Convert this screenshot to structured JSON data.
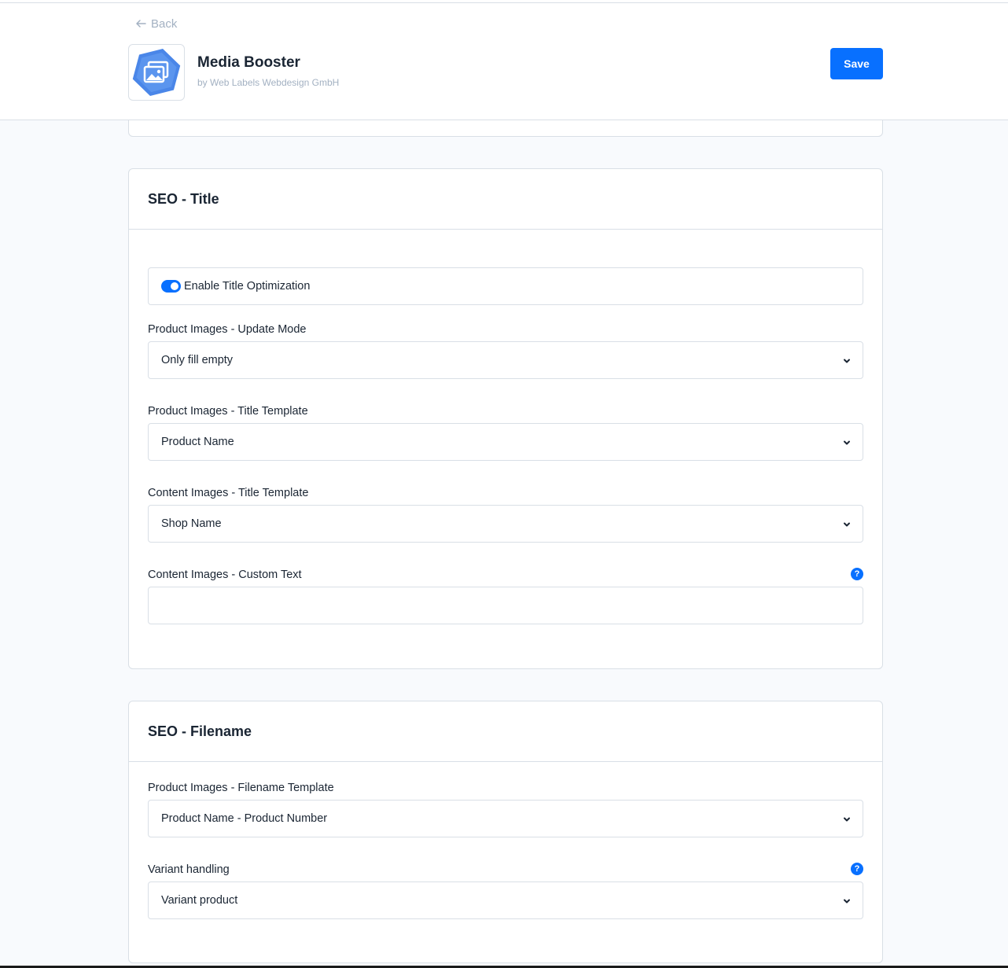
{
  "header": {
    "back_label": "Back",
    "app_name": "Media Booster",
    "vendor": "by Web Labels Webdesign GmbH",
    "save_label": "Save"
  },
  "seo_title": {
    "title": "SEO - Title",
    "toggle": {
      "label": "Enable Title Optimization",
      "enabled": true
    },
    "fields": [
      {
        "label": "Product Images - Update Mode",
        "value": "Only fill empty"
      },
      {
        "label": "Product Images - Title Template",
        "value": "Product Name"
      },
      {
        "label": "Content Images - Title Template",
        "value": "Shop Name"
      }
    ],
    "custom_text": {
      "label": "Content Images - Custom Text",
      "value": ""
    }
  },
  "seo_filename": {
    "title": "SEO - Filename",
    "fields": [
      {
        "label": "Product Images - Filename Template",
        "value": "Product Name - Product Number"
      },
      {
        "label": "Variant handling",
        "value": "Variant product"
      }
    ]
  },
  "icons": {
    "help": "?"
  },
  "colors": {
    "accent": "#0870ff",
    "border": "#d9dfe6",
    "muted": "#a3b1c2"
  }
}
